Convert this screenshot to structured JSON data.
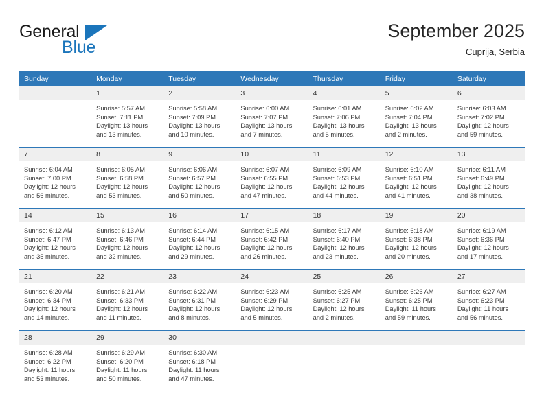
{
  "brand": {
    "name_part1": "General",
    "name_part2": "Blue",
    "logo_icon": "triangle-flag-icon",
    "accent_color": "#1b75bb"
  },
  "header": {
    "title": "September 2025",
    "location": "Cuprija, Serbia"
  },
  "theme": {
    "header_bg": "#2e78b8",
    "daynum_bg": "#efefef",
    "divider": "#2e78b8",
    "text": "#3a3a3a"
  },
  "calendar": {
    "weekday_headers": [
      "Sunday",
      "Monday",
      "Tuesday",
      "Wednesday",
      "Thursday",
      "Friday",
      "Saturday"
    ],
    "weeks": [
      [
        {
          "day": "",
          "sunrise": "",
          "sunset": "",
          "daylight_1": "",
          "daylight_2": ""
        },
        {
          "day": "1",
          "sunrise": "Sunrise: 5:57 AM",
          "sunset": "Sunset: 7:11 PM",
          "daylight_1": "Daylight: 13 hours",
          "daylight_2": "and 13 minutes."
        },
        {
          "day": "2",
          "sunrise": "Sunrise: 5:58 AM",
          "sunset": "Sunset: 7:09 PM",
          "daylight_1": "Daylight: 13 hours",
          "daylight_2": "and 10 minutes."
        },
        {
          "day": "3",
          "sunrise": "Sunrise: 6:00 AM",
          "sunset": "Sunset: 7:07 PM",
          "daylight_1": "Daylight: 13 hours",
          "daylight_2": "and 7 minutes."
        },
        {
          "day": "4",
          "sunrise": "Sunrise: 6:01 AM",
          "sunset": "Sunset: 7:06 PM",
          "daylight_1": "Daylight: 13 hours",
          "daylight_2": "and 5 minutes."
        },
        {
          "day": "5",
          "sunrise": "Sunrise: 6:02 AM",
          "sunset": "Sunset: 7:04 PM",
          "daylight_1": "Daylight: 13 hours",
          "daylight_2": "and 2 minutes."
        },
        {
          "day": "6",
          "sunrise": "Sunrise: 6:03 AM",
          "sunset": "Sunset: 7:02 PM",
          "daylight_1": "Daylight: 12 hours",
          "daylight_2": "and 59 minutes."
        }
      ],
      [
        {
          "day": "7",
          "sunrise": "Sunrise: 6:04 AM",
          "sunset": "Sunset: 7:00 PM",
          "daylight_1": "Daylight: 12 hours",
          "daylight_2": "and 56 minutes."
        },
        {
          "day": "8",
          "sunrise": "Sunrise: 6:05 AM",
          "sunset": "Sunset: 6:58 PM",
          "daylight_1": "Daylight: 12 hours",
          "daylight_2": "and 53 minutes."
        },
        {
          "day": "9",
          "sunrise": "Sunrise: 6:06 AM",
          "sunset": "Sunset: 6:57 PM",
          "daylight_1": "Daylight: 12 hours",
          "daylight_2": "and 50 minutes."
        },
        {
          "day": "10",
          "sunrise": "Sunrise: 6:07 AM",
          "sunset": "Sunset: 6:55 PM",
          "daylight_1": "Daylight: 12 hours",
          "daylight_2": "and 47 minutes."
        },
        {
          "day": "11",
          "sunrise": "Sunrise: 6:09 AM",
          "sunset": "Sunset: 6:53 PM",
          "daylight_1": "Daylight: 12 hours",
          "daylight_2": "and 44 minutes."
        },
        {
          "day": "12",
          "sunrise": "Sunrise: 6:10 AM",
          "sunset": "Sunset: 6:51 PM",
          "daylight_1": "Daylight: 12 hours",
          "daylight_2": "and 41 minutes."
        },
        {
          "day": "13",
          "sunrise": "Sunrise: 6:11 AM",
          "sunset": "Sunset: 6:49 PM",
          "daylight_1": "Daylight: 12 hours",
          "daylight_2": "and 38 minutes."
        }
      ],
      [
        {
          "day": "14",
          "sunrise": "Sunrise: 6:12 AM",
          "sunset": "Sunset: 6:47 PM",
          "daylight_1": "Daylight: 12 hours",
          "daylight_2": "and 35 minutes."
        },
        {
          "day": "15",
          "sunrise": "Sunrise: 6:13 AM",
          "sunset": "Sunset: 6:46 PM",
          "daylight_1": "Daylight: 12 hours",
          "daylight_2": "and 32 minutes."
        },
        {
          "day": "16",
          "sunrise": "Sunrise: 6:14 AM",
          "sunset": "Sunset: 6:44 PM",
          "daylight_1": "Daylight: 12 hours",
          "daylight_2": "and 29 minutes."
        },
        {
          "day": "17",
          "sunrise": "Sunrise: 6:15 AM",
          "sunset": "Sunset: 6:42 PM",
          "daylight_1": "Daylight: 12 hours",
          "daylight_2": "and 26 minutes."
        },
        {
          "day": "18",
          "sunrise": "Sunrise: 6:17 AM",
          "sunset": "Sunset: 6:40 PM",
          "daylight_1": "Daylight: 12 hours",
          "daylight_2": "and 23 minutes."
        },
        {
          "day": "19",
          "sunrise": "Sunrise: 6:18 AM",
          "sunset": "Sunset: 6:38 PM",
          "daylight_1": "Daylight: 12 hours",
          "daylight_2": "and 20 minutes."
        },
        {
          "day": "20",
          "sunrise": "Sunrise: 6:19 AM",
          "sunset": "Sunset: 6:36 PM",
          "daylight_1": "Daylight: 12 hours",
          "daylight_2": "and 17 minutes."
        }
      ],
      [
        {
          "day": "21",
          "sunrise": "Sunrise: 6:20 AM",
          "sunset": "Sunset: 6:34 PM",
          "daylight_1": "Daylight: 12 hours",
          "daylight_2": "and 14 minutes."
        },
        {
          "day": "22",
          "sunrise": "Sunrise: 6:21 AM",
          "sunset": "Sunset: 6:33 PM",
          "daylight_1": "Daylight: 12 hours",
          "daylight_2": "and 11 minutes."
        },
        {
          "day": "23",
          "sunrise": "Sunrise: 6:22 AM",
          "sunset": "Sunset: 6:31 PM",
          "daylight_1": "Daylight: 12 hours",
          "daylight_2": "and 8 minutes."
        },
        {
          "day": "24",
          "sunrise": "Sunrise: 6:23 AM",
          "sunset": "Sunset: 6:29 PM",
          "daylight_1": "Daylight: 12 hours",
          "daylight_2": "and 5 minutes."
        },
        {
          "day": "25",
          "sunrise": "Sunrise: 6:25 AM",
          "sunset": "Sunset: 6:27 PM",
          "daylight_1": "Daylight: 12 hours",
          "daylight_2": "and 2 minutes."
        },
        {
          "day": "26",
          "sunrise": "Sunrise: 6:26 AM",
          "sunset": "Sunset: 6:25 PM",
          "daylight_1": "Daylight: 11 hours",
          "daylight_2": "and 59 minutes."
        },
        {
          "day": "27",
          "sunrise": "Sunrise: 6:27 AM",
          "sunset": "Sunset: 6:23 PM",
          "daylight_1": "Daylight: 11 hours",
          "daylight_2": "and 56 minutes."
        }
      ],
      [
        {
          "day": "28",
          "sunrise": "Sunrise: 6:28 AM",
          "sunset": "Sunset: 6:22 PM",
          "daylight_1": "Daylight: 11 hours",
          "daylight_2": "and 53 minutes."
        },
        {
          "day": "29",
          "sunrise": "Sunrise: 6:29 AM",
          "sunset": "Sunset: 6:20 PM",
          "daylight_1": "Daylight: 11 hours",
          "daylight_2": "and 50 minutes."
        },
        {
          "day": "30",
          "sunrise": "Sunrise: 6:30 AM",
          "sunset": "Sunset: 6:18 PM",
          "daylight_1": "Daylight: 11 hours",
          "daylight_2": "and 47 minutes."
        },
        {
          "day": "",
          "sunrise": "",
          "sunset": "",
          "daylight_1": "",
          "daylight_2": ""
        },
        {
          "day": "",
          "sunrise": "",
          "sunset": "",
          "daylight_1": "",
          "daylight_2": ""
        },
        {
          "day": "",
          "sunrise": "",
          "sunset": "",
          "daylight_1": "",
          "daylight_2": ""
        },
        {
          "day": "",
          "sunrise": "",
          "sunset": "",
          "daylight_1": "",
          "daylight_2": ""
        }
      ]
    ]
  }
}
